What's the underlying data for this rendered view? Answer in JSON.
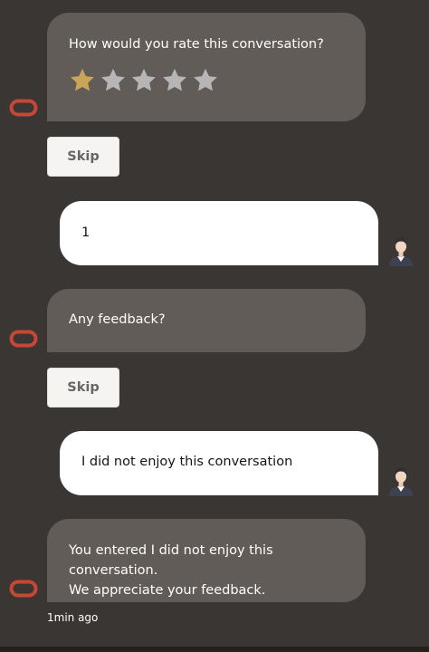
{
  "messages": {
    "rating_prompt": "How would you rate this conversation?",
    "rating_skip": "Skip",
    "user_rating": "1",
    "feedback_prompt": "Any feedback?",
    "feedback_skip": "Skip",
    "user_feedback": "I did not enjoy this conversation",
    "confirmation_line1": "You entered I did not enjoy this conversation.",
    "confirmation_line2": "We appreciate your feedback.",
    "timestamp": "1min ago"
  },
  "rating": {
    "selected": 1,
    "max": 5
  },
  "colors": {
    "background": "#3a3633",
    "bot_bubble": "#625c58",
    "user_bubble": "#ffffff",
    "star_filled": "#c9a45a",
    "star_empty": "#b7b5b5",
    "bot_avatar": "#c74634"
  },
  "icons": {
    "bot_avatar": "oracle-ring-icon",
    "user_avatar": "user-avatar-icon",
    "star": "star-icon"
  }
}
